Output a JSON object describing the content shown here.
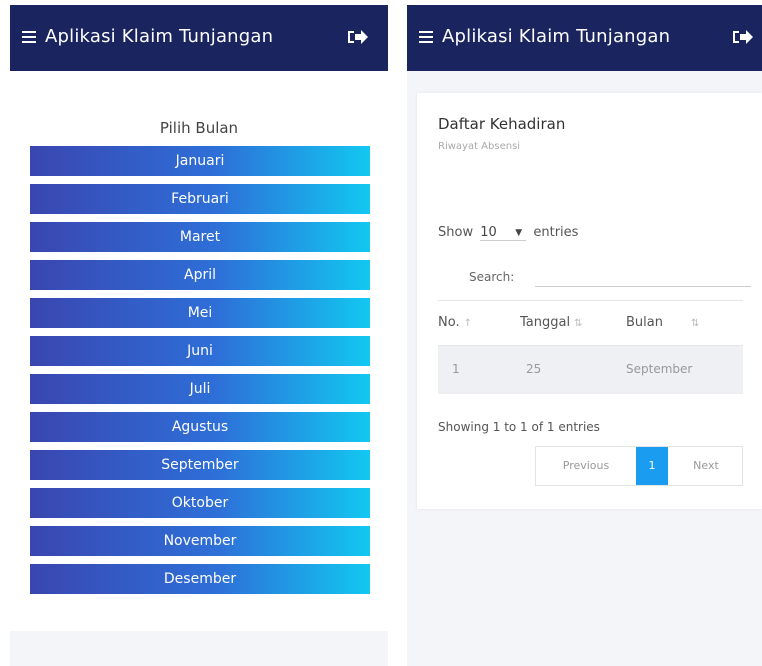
{
  "app": {
    "title": "Aplikasi Klaim Tunjangan"
  },
  "icons": {
    "menu": "hamburger-menu-icon",
    "logout": "logout-icon"
  },
  "colors": {
    "appbar": "#1a2560",
    "button_gradient_start": "#3a46b0",
    "button_gradient_end": "#12c8f0",
    "pagination_active": "#1a9cf0"
  },
  "month_picker": {
    "heading": "Pilih Bulan",
    "months": [
      "Januari",
      "Februari",
      "Maret",
      "April",
      "Mei",
      "Juni",
      "Juli",
      "Agustus",
      "September",
      "Oktober",
      "November",
      "Desember"
    ]
  },
  "attendance": {
    "title": "Daftar Kehadiran",
    "subtitle": "Riwayat Absensi",
    "show_label": "Show",
    "entries_value": "10",
    "entries_label": "entries",
    "search_label": "Search:",
    "search_value": "",
    "columns": [
      "No.",
      "Tanggal",
      "Bulan"
    ],
    "rows": [
      {
        "no": "1",
        "tanggal": "25",
        "bulan": "September"
      }
    ],
    "info": "Showing 1 to 1 of 1 entries",
    "pagination": {
      "previous": "Previous",
      "current": "1",
      "next": "Next"
    }
  }
}
